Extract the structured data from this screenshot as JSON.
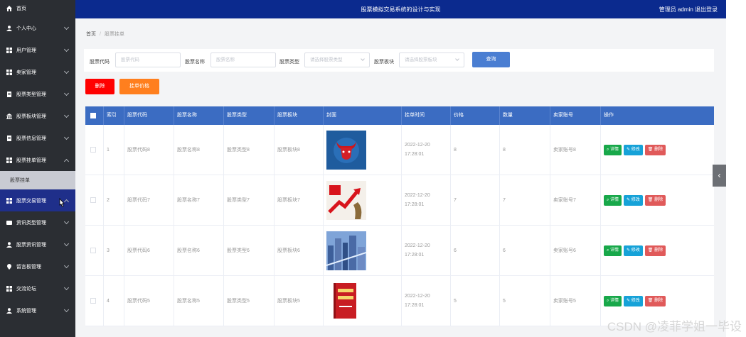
{
  "topbar": {
    "title": "股票模拟交易系统的设计与实现",
    "user": "管理员 admin  退出登录"
  },
  "sidebar": {
    "items": [
      {
        "label": "首页",
        "icon": "home-icon"
      },
      {
        "label": "个人中心",
        "icon": "user-icon"
      },
      {
        "label": "用户管理",
        "icon": "grid-icon"
      },
      {
        "label": "卖家管理",
        "icon": "grid-icon"
      },
      {
        "label": "股票类型管理",
        "icon": "doc-icon"
      },
      {
        "label": "股票板块管理",
        "icon": "bank-icon"
      },
      {
        "label": "股票信息管理",
        "icon": "doc-icon"
      },
      {
        "label": "股票挂单管理",
        "icon": "grid-icon"
      },
      {
        "label": "股票交易管理",
        "icon": "grid-icon"
      },
      {
        "label": "资讯类型管理",
        "icon": "card-icon"
      },
      {
        "label": "股票资讯管理",
        "icon": "user-icon"
      },
      {
        "label": "留言板管理",
        "icon": "pin-icon"
      },
      {
        "label": "交流论坛",
        "icon": "grid-icon"
      },
      {
        "label": "系统管理",
        "icon": "user-icon"
      }
    ],
    "sub_item": "股票挂单"
  },
  "breadcrumb": {
    "home": "首页",
    "current": "股票挂单"
  },
  "filters": {
    "code_label": "股票代码",
    "code_placeholder": "股票代码",
    "name_label": "股票名称",
    "name_placeholder": "股票名称",
    "type_label": "股票类型",
    "type_placeholder": "请选择股票类型",
    "block_label": "股票板块",
    "block_placeholder": "请选择股票板块",
    "query_label": "查询"
  },
  "actions": {
    "delete_label": "删除",
    "price_label": "挂单价格"
  },
  "table": {
    "headers": [
      "",
      "索引",
      "股票代码",
      "股票名称",
      "股票类型",
      "股票板块",
      "封面",
      "挂单时间",
      "价格",
      "数量",
      "卖家账号",
      "操作"
    ],
    "rows": [
      {
        "index": "1",
        "code": "股票代码8",
        "name": "股票名称8",
        "type": "股票类型8",
        "block": "股票板块8",
        "time": "2022-12-20 17:28:01",
        "price": "8",
        "qty": "8",
        "seller": "卖家账号8"
      },
      {
        "index": "2",
        "code": "股票代码7",
        "name": "股票名称7",
        "type": "股票类型7",
        "block": "股票板块7",
        "time": "2022-12-20 17:28:01",
        "price": "7",
        "qty": "7",
        "seller": "卖家账号7"
      },
      {
        "index": "3",
        "code": "股票代码6",
        "name": "股票名称6",
        "type": "股票类型6",
        "block": "股票板块6",
        "time": "2022-12-20 17:28:01",
        "price": "6",
        "qty": "6",
        "seller": "卖家账号6"
      },
      {
        "index": "4",
        "code": "股票代码5",
        "name": "股票名称5",
        "type": "股票类型5",
        "block": "股票板块5",
        "time": "2022-12-20 17:28:01",
        "price": "5",
        "qty": "5",
        "seller": "卖家账号5"
      }
    ],
    "ops": {
      "detail": "详情",
      "edit": "修改",
      "remove": "删除"
    }
  },
  "watermark": "CSDN @凌菲学姐一毕设"
}
